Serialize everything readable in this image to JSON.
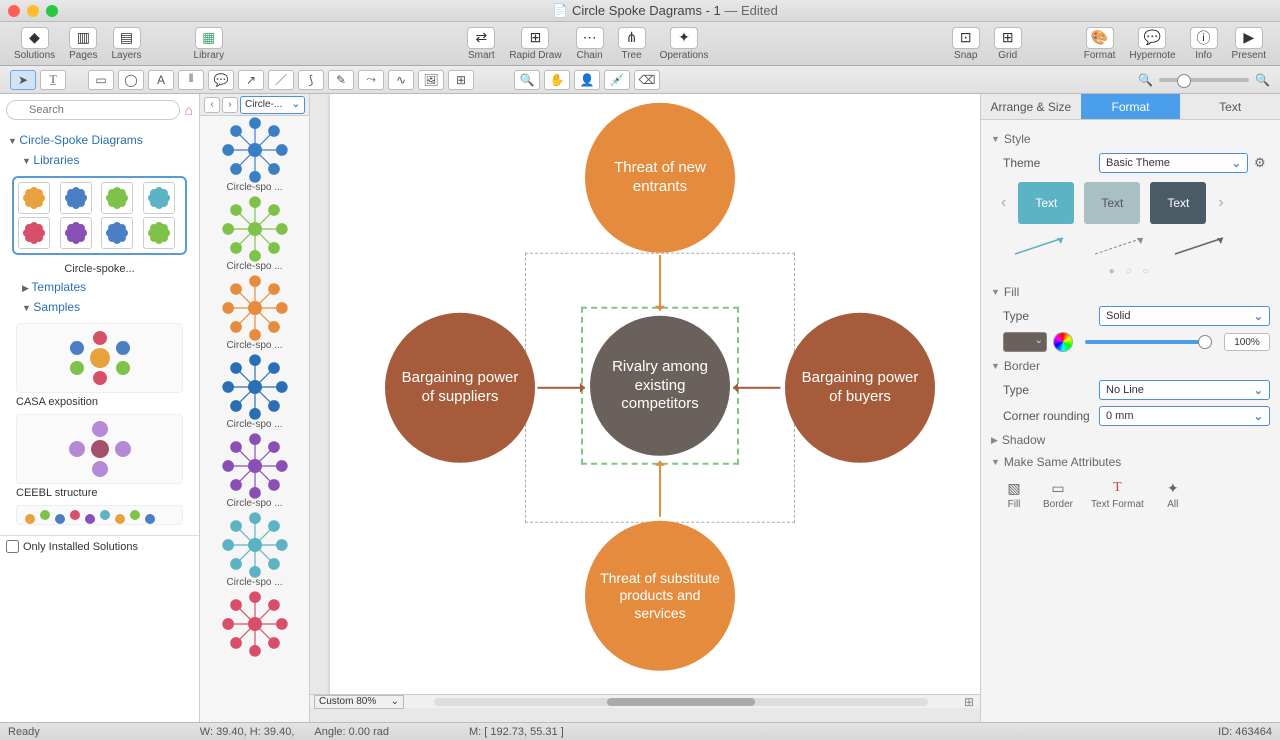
{
  "window": {
    "title": "Circle  Spoke Dagrams - 1",
    "state": "Edited"
  },
  "toolbar": {
    "left": [
      {
        "id": "solutions",
        "label": "Solutions",
        "glyph": "◆"
      },
      {
        "id": "pages",
        "label": "Pages",
        "glyph": "▥"
      },
      {
        "id": "layers",
        "label": "Layers",
        "glyph": "▤"
      }
    ],
    "library": {
      "label": "Library",
      "glyph": "▦"
    },
    "mid": [
      {
        "id": "smart",
        "label": "Smart",
        "glyph": "⇄"
      },
      {
        "id": "rapid",
        "label": "Rapid Draw",
        "glyph": "⊞"
      },
      {
        "id": "chain",
        "label": "Chain",
        "glyph": "⋯"
      },
      {
        "id": "tree",
        "label": "Tree",
        "glyph": "⋔"
      },
      {
        "id": "ops",
        "label": "Operations",
        "glyph": "✦"
      }
    ],
    "snap": [
      {
        "id": "snap",
        "label": "Snap",
        "glyph": "⊡"
      },
      {
        "id": "grid",
        "label": "Grid",
        "glyph": "⊞"
      }
    ],
    "right": [
      {
        "id": "format",
        "label": "Format",
        "glyph": "🎨"
      },
      {
        "id": "hypernote",
        "label": "Hypernote",
        "glyph": "💬"
      },
      {
        "id": "info",
        "label": "Info",
        "glyph": "ⓘ"
      },
      {
        "id": "present",
        "label": "Present",
        "glyph": "▶"
      }
    ]
  },
  "tools": {
    "pointer": "pointer",
    "textcursor": "text-cursor",
    "shapes": [
      "rect",
      "ellipse",
      "text",
      "textbox",
      "callout",
      "arrow",
      "line",
      "curve",
      "pen",
      "connector",
      "spline",
      "image",
      "container"
    ],
    "view": [
      "zoom",
      "hand",
      "stamp",
      "eyedrop",
      "erase"
    ]
  },
  "leftPanel": {
    "searchPlaceholder": "Search",
    "heading": "Circle-Spoke Diagrams",
    "libraries": "Libraries",
    "libThumbLabel": "Circle-spoke...",
    "templates": "Templates",
    "samples": "Samples",
    "sampleList": [
      {
        "label": "CASA exposition"
      },
      {
        "label": "CEEBL structure"
      }
    ],
    "onlyInstalled": "Only Installed Solutions"
  },
  "shapesPanel": {
    "selector": "Circle-...",
    "items": [
      {
        "label": "Circle-spo ...",
        "color": "#3a7fc4"
      },
      {
        "label": "Circle-spo ...",
        "color": "#7fc24a"
      },
      {
        "label": "Circle-spo ...",
        "color": "#e78b3e"
      },
      {
        "label": "Circle-spo ...",
        "color": "#2a6fb5"
      },
      {
        "label": "Circle-spo ...",
        "color": "#8a4fb5"
      },
      {
        "label": "Circle-spo ...",
        "color": "#5bb3c4"
      },
      {
        "label": "",
        "color": "#d94f6a"
      }
    ]
  },
  "diagram": {
    "center": "Rivalry among existing competitors",
    "top": "Threat of new entrants",
    "bottom": "Threat of substitute products and services",
    "left": "Bargaining power of suppliers",
    "right": "Bargaining power of buyers"
  },
  "canvas": {
    "zoom": "Custom 80%"
  },
  "inspector": {
    "tabs": [
      "Arrange & Size",
      "Format",
      "Text"
    ],
    "activeTab": 1,
    "style": {
      "section": "Style",
      "themeLabel": "Theme",
      "theme": "Basic Theme",
      "preview": [
        "Text",
        "Text",
        "Text"
      ]
    },
    "fill": {
      "section": "Fill",
      "typeLabel": "Type",
      "type": "Solid",
      "opacity": "100%"
    },
    "border": {
      "section": "Border",
      "typeLabel": "Type",
      "type": "No Line",
      "cornerLabel": "Corner rounding",
      "corner": "0 mm"
    },
    "shadow": {
      "section": "Shadow"
    },
    "msa": {
      "section": "Make Same Attributes",
      "items": [
        "Fill",
        "Border",
        "Text Format",
        "All"
      ]
    }
  },
  "status": {
    "ready": "Ready",
    "size": "W: 39.40,  H: 39.40,",
    "angle": "Angle: 0.00 rad",
    "mouse": "M: [ 192.73, 55.31 ]",
    "id": "ID: 463464"
  }
}
